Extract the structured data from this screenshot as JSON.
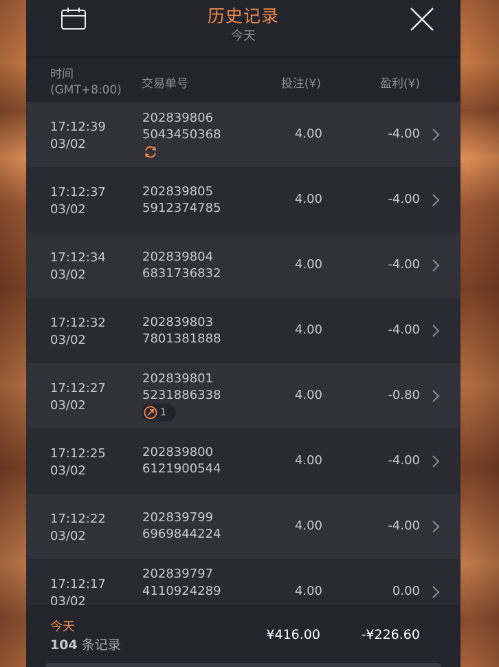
{
  "header": {
    "title": "历史记录",
    "subtitle": "今天"
  },
  "columns": {
    "time_line1": "时间",
    "time_line2": "(GMT+8:00)",
    "order": "交易单号",
    "stake": "投注(¥)",
    "profit": "盈利(¥)"
  },
  "rows": [
    {
      "time": "17:12:39",
      "date": "03/02",
      "order1": "202839806",
      "order2": "5043450368",
      "stake": "4.00",
      "profit": "-4.00",
      "badge": "refresh"
    },
    {
      "time": "17:12:37",
      "date": "03/02",
      "order1": "202839805",
      "order2": "5912374785",
      "stake": "4.00",
      "profit": "-4.00"
    },
    {
      "time": "17:12:34",
      "date": "03/02",
      "order1": "202839804",
      "order2": "6831736832",
      "stake": "4.00",
      "profit": "-4.00"
    },
    {
      "time": "17:12:32",
      "date": "03/02",
      "order1": "202839803",
      "order2": "7801381888",
      "stake": "4.00",
      "profit": "-4.00"
    },
    {
      "time": "17:12:27",
      "date": "03/02",
      "order1": "202839801",
      "order2": "5231886338",
      "stake": "4.00",
      "profit": "-0.80",
      "badge_count": "1"
    },
    {
      "time": "17:12:25",
      "date": "03/02",
      "order1": "202839800",
      "order2": "6121900544",
      "stake": "4.00",
      "profit": "-4.00"
    },
    {
      "time": "17:12:22",
      "date": "03/02",
      "order1": "202839799",
      "order2": "6969844224",
      "stake": "4.00",
      "profit": "-4.00"
    },
    {
      "time": "17:12:17",
      "date": "03/02",
      "order1": "202839797",
      "order2": "4110924289",
      "stake": "4.00",
      "profit": "0.00"
    }
  ],
  "footer": {
    "today": "今天",
    "count": "104",
    "count_suffix": "条记录",
    "total_stake": "¥416.00",
    "total_profit": "-¥226.60"
  },
  "colors": {
    "accent": "#f08a4b",
    "panel": "#2a2a33",
    "row_alt": "#31313a",
    "header": "#24242c"
  },
  "icons": {
    "calendar": "calendar-icon",
    "close": "close-icon",
    "chevron": "chevron-right-icon",
    "refresh": "refresh-icon",
    "cashout": "cashout-icon"
  }
}
